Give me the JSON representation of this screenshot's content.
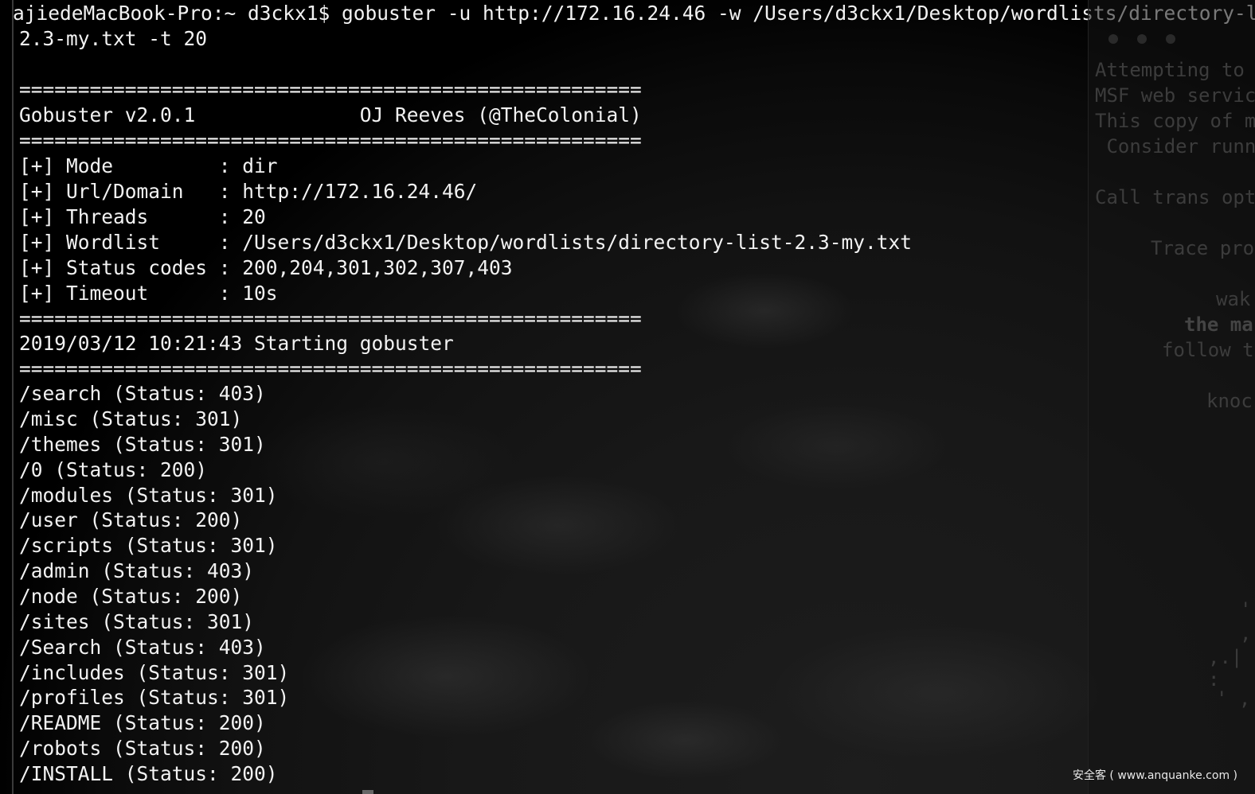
{
  "terminal": {
    "prompt_line_1": "ajiedeMacBook-Pro:~ d3ckx1$ gobuster -u http://172.16.24.46 -w /Users/d3ckx1/Desktop/wordlists/directory-list-",
    "prompt_line_2": "2.3-my.txt -t 20",
    "rule": "=====================================================",
    "banner": "Gobuster v2.0.1              OJ Reeves (@TheColonial)",
    "config": [
      "[+] Mode         : dir",
      "[+] Url/Domain   : http://172.16.24.46/",
      "[+] Threads      : 20",
      "[+] Wordlist     : /Users/d3ckx1/Desktop/wordlists/directory-list-2.3-my.txt",
      "[+] Status codes : 200,204,301,302,307,403",
      "[+] Timeout      : 10s"
    ],
    "start_message": "2019/03/12 10:21:43 Starting gobuster",
    "results": [
      "/search (Status: 403)",
      "/misc (Status: 301)",
      "/themes (Status: 301)",
      "/0 (Status: 200)",
      "/modules (Status: 301)",
      "/user (Status: 200)",
      "/scripts (Status: 301)",
      "/admin (Status: 403)",
      "/node (Status: 200)",
      "/sites (Status: 301)",
      "/Search (Status: 403)",
      "/includes (Status: 301)",
      "/profiles (Status: 301)",
      "/README (Status: 200)",
      "/robots (Status: 200)",
      "/INSTALL (Status: 200)"
    ]
  },
  "side_pane": {
    "lines": [
      "Attempting to",
      "MSF web servic",
      "This copy of m",
      " Consider runn",
      "Call trans opt",
      "Trace pro",
      "wak",
      "the ma",
      "follow t",
      "knoc",
      "'",
      ",",
      ",.|",
      ":",
      "' ,"
    ]
  },
  "watermark": "安全客 ( www.anquanke.com )",
  "colors": {
    "text": "#f2f2f2",
    "background": "#000000",
    "faded_text": "#3c3c3c"
  }
}
